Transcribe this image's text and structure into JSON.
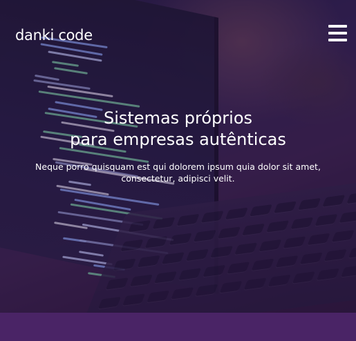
{
  "header": {
    "logo_text": "danki code",
    "menu_icon": "hamburger-menu-icon"
  },
  "hero": {
    "title_line1": "Sistemas próprios",
    "title_line2": "para empresas autênticas",
    "subtitle": "Neque porro quisquam est qui dolorem ipsum quia dolor sit amet, consectetur, adipisci velit."
  },
  "colors": {
    "overlay": "#371950",
    "band": "#4a2466",
    "text": "#ffffff"
  }
}
